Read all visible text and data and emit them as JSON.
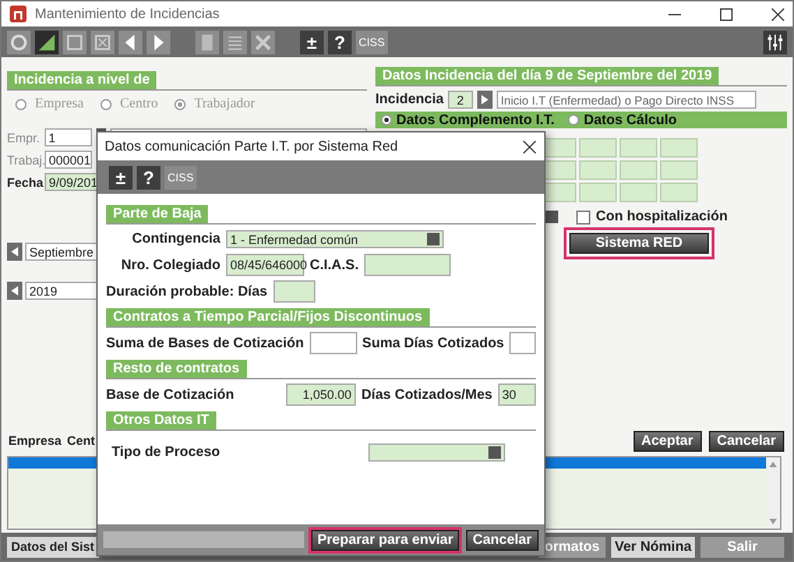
{
  "window": {
    "title": "Mantenimiento de Incidencias"
  },
  "toolbar": {
    "text_buttons": [
      "±",
      "?",
      "CISS"
    ]
  },
  "level_panel": {
    "title": "Incidencia a nivel de",
    "options": [
      {
        "label": "Empresa",
        "selected": false
      },
      {
        "label": "Centro",
        "selected": false
      },
      {
        "label": "Trabajador",
        "selected": true
      }
    ]
  },
  "employer": {
    "label": "Empr.",
    "value": "1"
  },
  "worker": {
    "label": "Trabaj.",
    "value": "000001"
  },
  "date": {
    "label": "Fecha",
    "value": "9/09/201"
  },
  "month": "Septiembre",
  "year": "2019",
  "list": {
    "columns": [
      "Empresa",
      "Cent"
    ]
  },
  "system_button": "Datos del Sist",
  "incidence_panel": {
    "title": "Datos Incidencia del día  9 de Septiembre del 2019",
    "label": "Incidencia",
    "code": "2",
    "description": "Inicio I.T (Enfermedad) o Pago Directo INSS",
    "tabs": [
      {
        "label": "Datos Complemento I.T.",
        "selected": true
      },
      {
        "label": "Datos Cálculo",
        "selected": false
      }
    ],
    "hospitalization": {
      "label": "Con hospitalización",
      "checked": false
    },
    "red_button": "Sistema RED"
  },
  "actions": [
    "Aceptar",
    "Cancelar"
  ],
  "footer_buttons": [
    {
      "label": "ormatos",
      "disabled": true
    },
    {
      "label": "Ver Nómina",
      "disabled": false
    },
    {
      "label": "Salir",
      "disabled": true
    }
  ],
  "dialog": {
    "title": "Datos comunicación Parte I.T. por Sistema Red",
    "toolbar": [
      "±",
      "?",
      "CISS"
    ],
    "parte_de_baja": {
      "title": "Parte de Baja",
      "contingencia": {
        "label": "Contingencia",
        "value": "1 - Enfermedad común"
      },
      "colegiado": {
        "label": "Nro. Colegiado",
        "value": "08/45/646000"
      },
      "cias": {
        "label": "C.I.A.S."
      },
      "duracion": {
        "label": "Duración probable: Días"
      }
    },
    "parcial": {
      "title": "Contratos a Tiempo Parcial/Fijos Discontinuos",
      "suma_bases": {
        "label": "Suma de Bases de Cotización"
      },
      "suma_dias": {
        "label": "Suma Días Cotizados"
      }
    },
    "resto": {
      "title": "Resto de contratos",
      "base": {
        "label": "Base de Cotización",
        "value": "1,050.00"
      },
      "dias": {
        "label": "Días Cotizados/Mes",
        "value": "30"
      }
    },
    "otros": {
      "title": "Otros Datos IT",
      "tipo": {
        "label": "Tipo de Proceso"
      }
    },
    "buttons": [
      {
        "label": "Preparar para enviar",
        "highlighted": true
      },
      {
        "label": "Cancelar",
        "highlighted": false
      }
    ]
  }
}
